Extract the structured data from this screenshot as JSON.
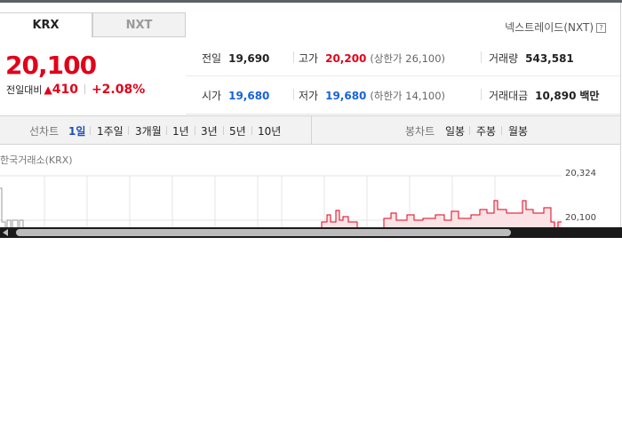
{
  "tabs": [
    {
      "label": "KRX",
      "active": true
    },
    {
      "label": "NXT",
      "active": false
    }
  ],
  "nextrade_label": "넥스트레이드(NXT)",
  "help_icon": "?",
  "price": {
    "current": "20,100",
    "change_label": "전일대비",
    "change_arrow": "▲",
    "change_value": "410",
    "change_pct": "+2.08%",
    "color": "#e0021b"
  },
  "stats": {
    "prev_close": {
      "label": "전일",
      "value": "19,690"
    },
    "high": {
      "label": "고가",
      "value": "20,200",
      "note": "(상한가 26,100)"
    },
    "volume": {
      "label": "거래량",
      "value": "543,581"
    },
    "open": {
      "label": "시가",
      "value": "19,680"
    },
    "low": {
      "label": "저가",
      "value": "19,680",
      "note": "(하한가 14,100)"
    },
    "amount": {
      "label": "거래대금",
      "value": "10,890",
      "unit": "백만"
    }
  },
  "toolbar": {
    "line_label": "선차트",
    "line_periods": [
      "1일",
      "1주일",
      "3개월",
      "1년",
      "3년",
      "5년",
      "10년"
    ],
    "active_period": "1일",
    "candle_label": "봉차트",
    "candle_periods": [
      "일봉",
      "주봉",
      "월봉"
    ]
  },
  "chart": {
    "source": "한국거래소(KRX)",
    "y_ticks": [
      "20,324",
      "20,100"
    ],
    "line_color": "#e0021b"
  }
}
